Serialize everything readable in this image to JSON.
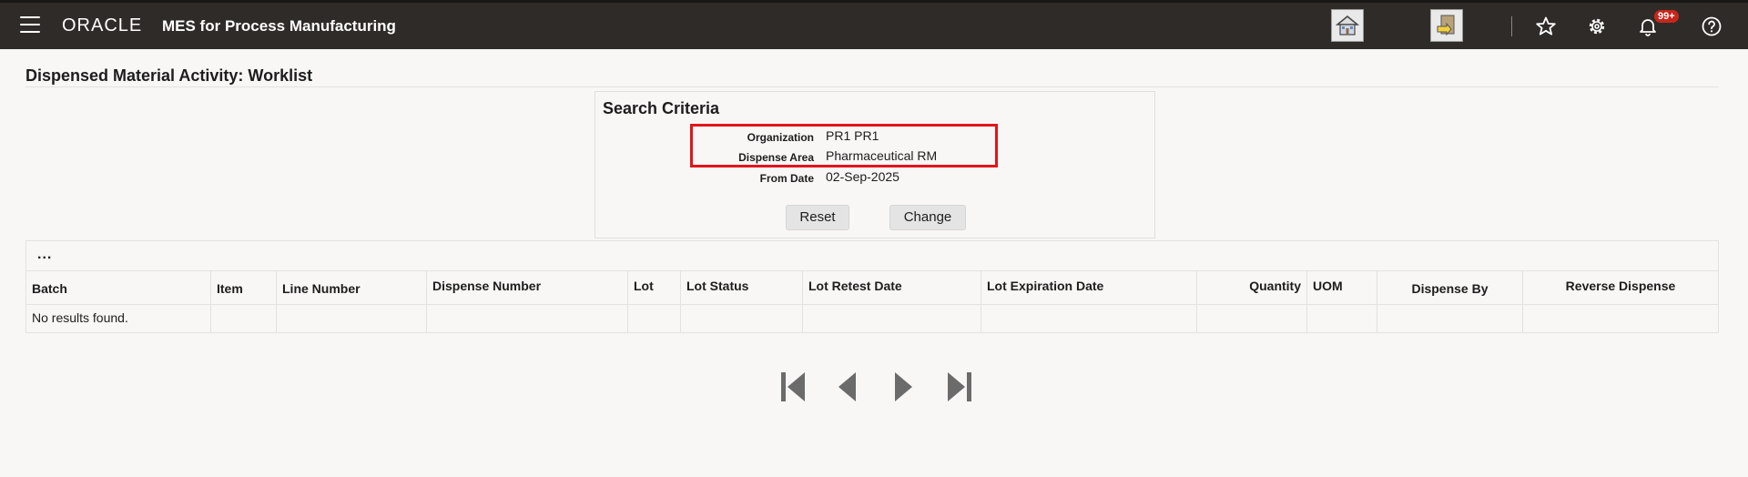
{
  "header": {
    "brand": "ORACLE",
    "app_title": "MES for Process Manufacturing",
    "notification_badge": "99+",
    "icons": [
      "menu-icon",
      "home-icon",
      "dispense-icon",
      "star-icon",
      "gear-icon",
      "bell-icon",
      "help-icon"
    ]
  },
  "page": {
    "title": "Dispensed Material Activity: Worklist"
  },
  "search": {
    "title": "Search Criteria",
    "fields": [
      {
        "label": "Organization",
        "value": "PR1 PR1"
      },
      {
        "label": "Dispense Area",
        "value": "Pharmaceutical RM"
      },
      {
        "label": "From Date",
        "value": "02-Sep-2025"
      }
    ],
    "reset_label": "Reset",
    "change_label": "Change"
  },
  "table": {
    "toolbar_more": "...",
    "columns": [
      "Batch",
      "Item",
      "Line Number",
      "Dispense Number",
      "Lot",
      "Lot Status",
      "Lot Retest Date",
      "Lot Expiration Date",
      "Quantity",
      "UOM",
      "Dispense By",
      "Reverse Dispense"
    ],
    "empty_message": "No results found."
  },
  "pager": {
    "buttons": [
      "first-page",
      "previous-page",
      "next-page",
      "last-page"
    ]
  },
  "colors": {
    "header_bg": "#2f2b28",
    "highlight": "#e3141b",
    "badge": "#c7271b",
    "page_bg": "#f8f7f5"
  }
}
